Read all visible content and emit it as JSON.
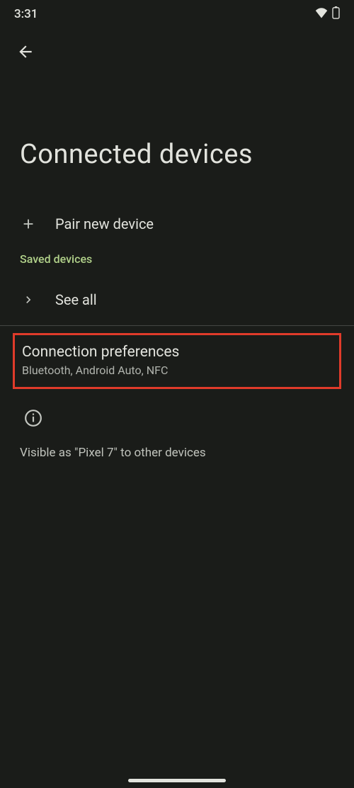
{
  "status": {
    "time": "3:31"
  },
  "header": {
    "title": "Connected devices"
  },
  "actions": {
    "pair": "Pair new device",
    "seeAll": "See all"
  },
  "sections": {
    "savedDevices": "Saved devices"
  },
  "preferences": {
    "title": "Connection preferences",
    "subtitle": "Bluetooth, Android Auto, NFC"
  },
  "info": {
    "visibility": "Visible as \"Pixel 7\" to other devices"
  }
}
